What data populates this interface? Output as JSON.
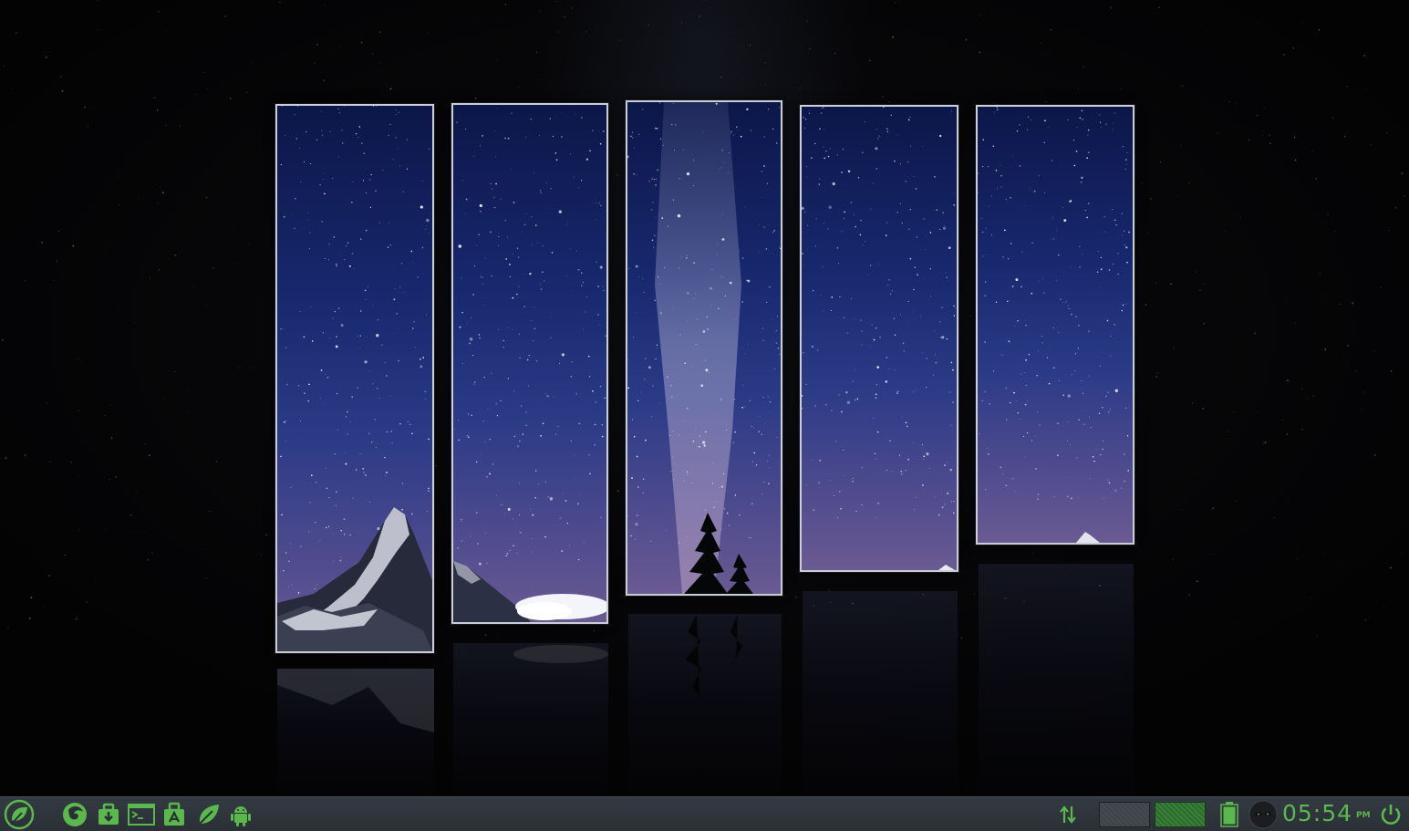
{
  "desktop": {
    "wallpaper_description_icon": "starry-mountain-panels"
  },
  "taskbar": {
    "start_icon": "leaf-menu-icon",
    "launchers": [
      {
        "name": "firefox-icon"
      },
      {
        "name": "software-center-icon"
      },
      {
        "name": "terminal-icon"
      },
      {
        "name": "app-store-icon"
      },
      {
        "name": "mint-leaf-icon"
      },
      {
        "name": "android-icon"
      }
    ],
    "tray": {
      "network_icon": "network-arrows-icon",
      "battery_icon": "battery-icon",
      "user_icon": "user-avatar-icon",
      "power_icon": "power-icon"
    },
    "clock": {
      "time": "05:54",
      "ampm": "PM"
    }
  },
  "colors": {
    "accent": "#5bb84d",
    "taskbar_bg": "#2f343b",
    "panel_border": "#c9cdd6",
    "sky_top": "#0c1648",
    "sky_bottom": "#6a5a92"
  }
}
